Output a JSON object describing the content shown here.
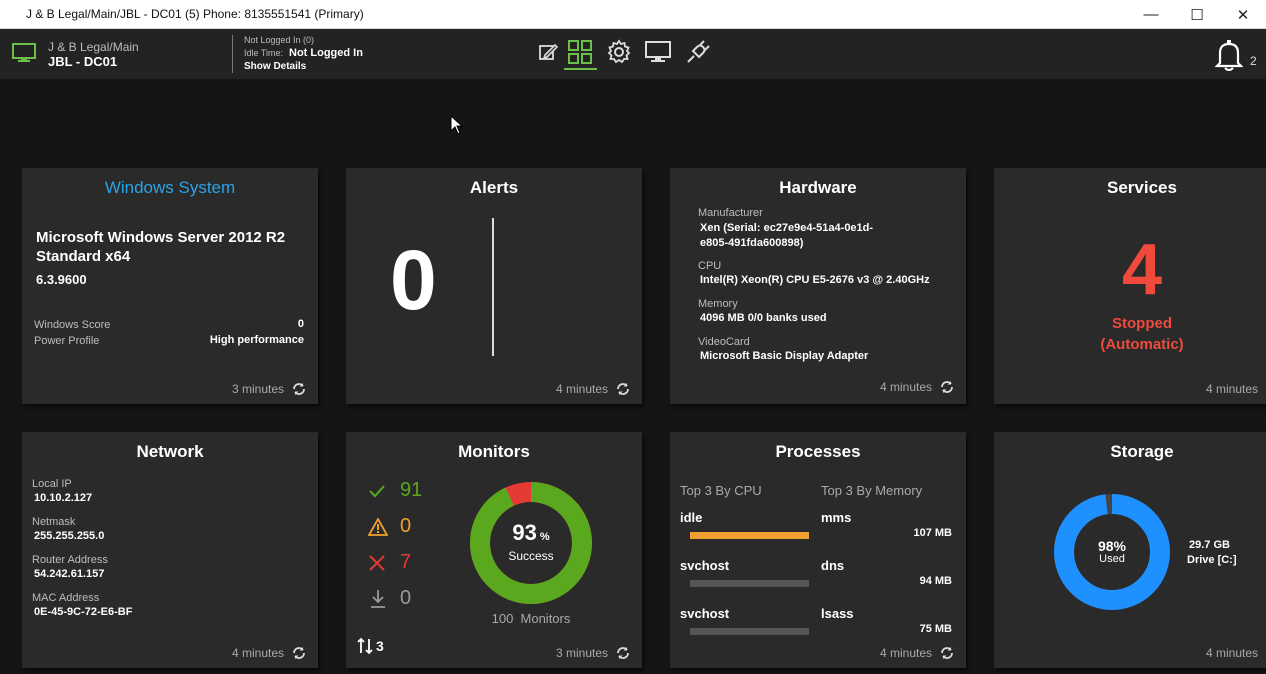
{
  "window": {
    "title": "J & B Legal/Main/JBL - DC01 (5) Phone: 8135551541 (Primary)",
    "minimize": "—",
    "maximize": "☐",
    "close": "✕"
  },
  "toolbar": {
    "device_group": "J & B Legal/Main",
    "device_name": "JBL - DC01",
    "login_status": "Not Logged In (0)",
    "idle_label": "Idle Time:",
    "idle_value": "Not Logged In",
    "show_details": "Show Details",
    "notifications_count": "2",
    "accent": "#6cc04a"
  },
  "windows_system": {
    "title": "Windows System",
    "os": "Microsoft Windows Server 2012 R2 Standard x64",
    "version": "6.3.9600",
    "score_label": "Windows Score",
    "score_value": "0",
    "power_label": "Power Profile",
    "power_value": "High performance",
    "updated": "3 minutes",
    "title_color": "#2aa3e6"
  },
  "alerts": {
    "title": "Alerts",
    "count": "0",
    "updated": "4 minutes"
  },
  "hardware": {
    "title": "Hardware",
    "manufacturer_label": "Manufacturer",
    "manufacturer_value": "Xen (Serial: ec27e9e4-51a4-0e1d-e805-491fda600898)",
    "cpu_label": "CPU",
    "cpu_value": "Intel(R) Xeon(R) CPU E5-2676 v3 @ 2.40GHz",
    "memory_label": "Memory",
    "memory_value": "4096 MB 0/0 banks used",
    "video_label": "VideoCard",
    "video_value": "Microsoft Basic Display Adapter",
    "updated": "4 minutes"
  },
  "services": {
    "title": "Services",
    "count": "4",
    "status_line1": "Stopped",
    "status_line2": "(Automatic)",
    "updated": "4 minutes",
    "color": "#ef4a3c"
  },
  "network": {
    "title": "Network",
    "local_ip_label": "Local IP",
    "local_ip": "10.10.2.127",
    "netmask_label": "Netmask",
    "netmask": "255.255.255.0",
    "router_label": "Router Address",
    "router": "54.242.61.157",
    "mac_label": "MAC Address",
    "mac": "0E-45-9C-72-E6-BF",
    "updated": "4 minutes"
  },
  "monitors": {
    "title": "Monitors",
    "ok_count": "91",
    "warning_count": "0",
    "failed_count": "7",
    "down_count": "0",
    "sort_count": "3",
    "success_pct": "93",
    "pct_sign": "%",
    "success_label": "Success",
    "total_label": "100  Monitors",
    "success_fraction": 0.93,
    "updated": "3 minutes",
    "ok_color": "#59a81d",
    "fail_color": "#e53935"
  },
  "processes": {
    "title": "Processes",
    "cpu_header": "Top 3 By CPU",
    "mem_header": "Top 3 By Memory",
    "cpu": [
      {
        "name": "idle",
        "fraction": 1.0
      },
      {
        "name": "svchost",
        "fraction": 0.0
      },
      {
        "name": "svchost",
        "fraction": 0.0
      }
    ],
    "memory": [
      {
        "name": "mms",
        "value": "107 MB"
      },
      {
        "name": "dns",
        "value": "94 MB"
      },
      {
        "name": "lsass",
        "value": "75 MB"
      }
    ],
    "bar_color": "#f0a030",
    "updated": "4 minutes"
  },
  "storage": {
    "title": "Storage",
    "used_pct": "98%",
    "used_label": "Used",
    "size": "29.7 GB",
    "drive": "Drive [C:]",
    "used_fraction": 0.98,
    "ring_color": "#1e90ff",
    "updated": "4 minutes"
  }
}
